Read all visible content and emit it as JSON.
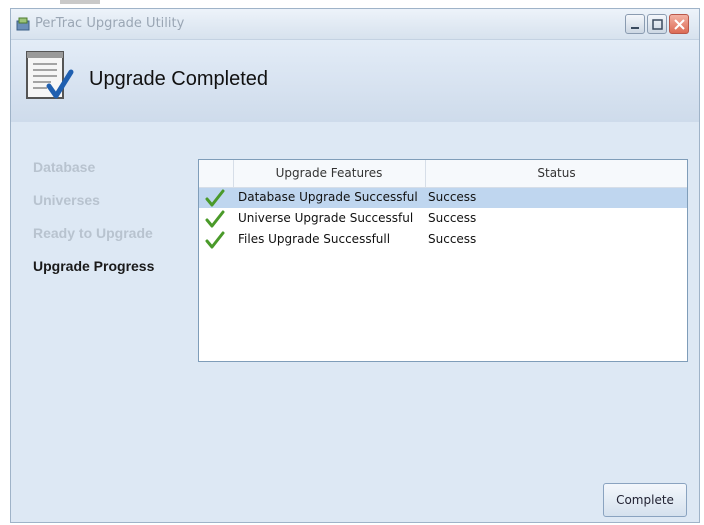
{
  "window": {
    "title": "PerTrac Upgrade Utility"
  },
  "header": {
    "title": "Upgrade Completed",
    "icon": "document-checkmark-icon"
  },
  "steps": [
    {
      "label": "Database",
      "active": false
    },
    {
      "label": "Universes",
      "active": false
    },
    {
      "label": "Ready to Upgrade",
      "active": false
    },
    {
      "label": "Upgrade Progress",
      "active": true
    }
  ],
  "grid": {
    "columns": [
      "",
      "Upgrade Features",
      "Status"
    ],
    "rows": [
      {
        "icon": "green-check-icon",
        "feature": "Database Upgrade Successful",
        "status": "Success",
        "selected": true
      },
      {
        "icon": "green-check-icon",
        "feature": "Universe Upgrade Successful",
        "status": "Success",
        "selected": false
      },
      {
        "icon": "green-check-icon",
        "feature": "Files Upgrade Successfull",
        "status": "Success",
        "selected": false
      }
    ]
  },
  "buttons": {
    "complete_label": "Complete"
  },
  "colors": {
    "selected_row": "#bfd6ef",
    "active_step": "#1a1a1a",
    "inactive_step": "#b8c3cf",
    "check": "#4a9a2a"
  }
}
